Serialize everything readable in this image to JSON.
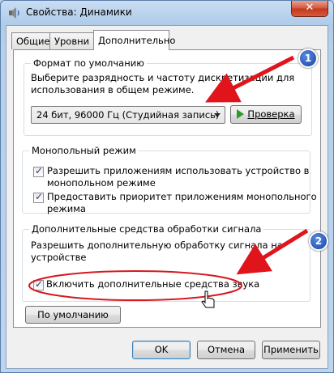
{
  "window": {
    "title": "Свойства: Динамики",
    "close_label": "✕"
  },
  "tabs": [
    {
      "label": "Общие"
    },
    {
      "label": "Уровни"
    },
    {
      "label": "Дополнительно"
    }
  ],
  "default_format": {
    "title": "Формат по умолчанию",
    "description_line1": "Выберите разрядность и частоту дискретизации для",
    "description_line2": "использования в общем режиме.",
    "selected_format": "24 бит, 96000 Гц (Студийная запись)",
    "test_button": "Проверка"
  },
  "exclusive_mode": {
    "title": "Монопольный режим",
    "option1_line1": "Разрешить приложениям использовать устройство в",
    "option1_line2": "монопольном режиме",
    "option1_checked": true,
    "option2_line1": "Предоставить приоритет приложениям монопольного",
    "option2_line2": "режима",
    "option2_checked": true
  },
  "enhancements": {
    "title": "Дополнительные средства обработки сигнала",
    "description_line1": "Разрешить дополнительную обработку сигнала на",
    "description_line2": "устройстве",
    "checkbox_label": "Включить дополнительные средства звука",
    "checkbox_checked": true
  },
  "defaults_button": "По умолчанию",
  "footer": {
    "ok": "OK",
    "cancel": "Отмена",
    "apply": "Применить"
  },
  "annotations": {
    "badge1": "1",
    "badge2": "2",
    "arrow_color": "#e0141b"
  }
}
